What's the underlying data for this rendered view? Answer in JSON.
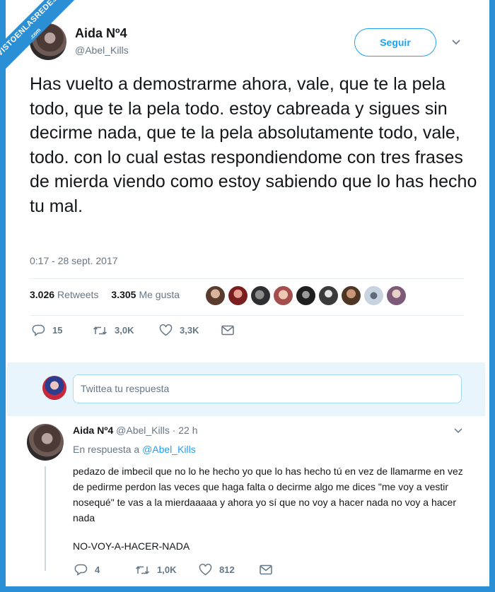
{
  "ribbon": {
    "line1": "VISTOENLASREDES",
    "line2": ".com"
  },
  "tweet": {
    "name": "Aida Nº4",
    "handle": "@Abel_Kills",
    "follow_label": "Seguir",
    "text": "Has vuelto a demostrarme ahora, vale, que te la pela todo, que te la pela todo. estoy cabreada y sigues sin decirme nada, que te la pela absolutamente todo, vale, todo. con lo cual estas respondiendome con tres frases de mierda viendo como estoy sabiendo que lo has hecho tu mal.",
    "timestamp": "0:17 - 28 sept. 2017",
    "retweets_count": "3.026",
    "retweets_label": "Retweets",
    "likes_count": "3.305",
    "likes_label": "Me gusta",
    "actions": {
      "replies": "15",
      "retweets": "3,0K",
      "likes": "3,3K"
    }
  },
  "compose": {
    "placeholder": "Twittea tu respuesta"
  },
  "reply": {
    "name": "Aida Nº4",
    "handle": "@Abel_Kills",
    "time": "· 22 h",
    "in_reply_prefix": "En respuesta a",
    "in_reply_handle": "@Abel_Kills",
    "text": "pedazo de imbecil que no lo he hecho yo que lo has hecho tú en vez de llamarme en vez de pedirme perdon las veces que haga falta o decirme algo me dices \"me voy a vestir nosequé\" te vas a la mierdaaaaa y ahora yo sí que no voy a hacer nada no voy a hacer nada",
    "text2": "NO-VOY-A-HACER-NADA",
    "actions": {
      "replies": "4",
      "retweets": "1,0K",
      "likes": "812"
    }
  },
  "colors": {
    "accent": "#1da1f2",
    "frame": "#2b8fd6",
    "muted": "#657786"
  }
}
